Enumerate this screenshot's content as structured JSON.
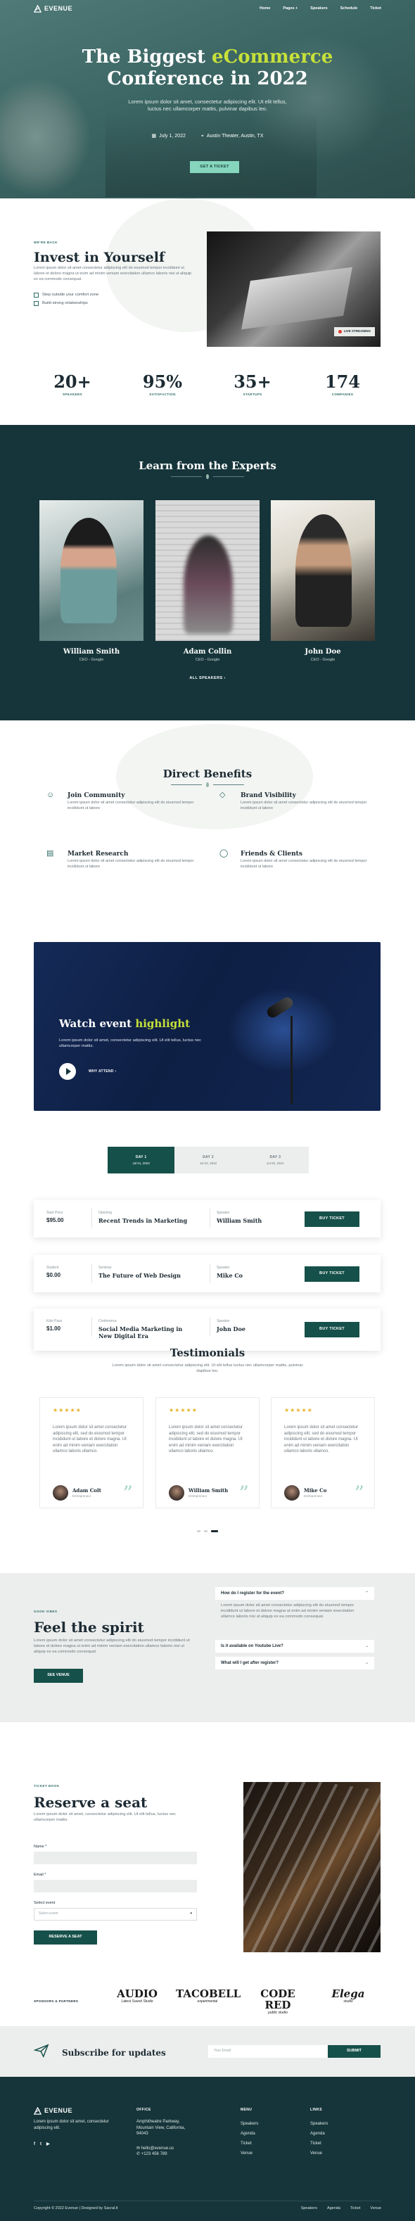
{
  "brand": {
    "name": "EVENUE",
    "accent": "#c7e03a",
    "primary": "#16504a",
    "dark": "#16353a",
    "mint": "#86d6bd"
  },
  "nav": {
    "items": [
      "Home",
      "Pages +",
      "Speakers",
      "Schedule",
      "Ticket"
    ]
  },
  "hero": {
    "title_a": "The Biggest ",
    "title_hl": "eCommerce",
    "title_b": "Conference in 2022",
    "sub_1": "Lorem ipsum dolor sit amet, consectetur adipiscing elit. Ut elit tellus,",
    "sub_2": "luctus nec ullamcorper mattis, pulvinar dapibus leo.",
    "date": "July 1, 2022",
    "place": "Austin Theater, Austin, TX",
    "cta": "GET A TICKET"
  },
  "invest": {
    "eyebrow": "WE'RE BACK",
    "title": "Invest in Yourself",
    "text": "Lorem ipsum dolor sit amet consectetur adipiscing elit do eiusmod tempor incididunt ut labore et dolore magna ut enim ad minim veniam exercitation ullamco laboris nisi ut aliquip ex ea commodo consequat.",
    "check_1": "Step outside your comfort zone",
    "check_2": "Build strong relationships",
    "live": "LIVE STREAMING"
  },
  "stats": [
    {
      "n": "20+",
      "l": "SPEAKERS"
    },
    {
      "n": "95%",
      "l": "SATISFACTION"
    },
    {
      "n": "35+",
      "l": "STARTUPS"
    },
    {
      "n": "174",
      "l": "COMPANIES"
    }
  ],
  "experts": {
    "title": "Learn from the Experts",
    "all": "ALL SPEAKERS  ›",
    "speakers": [
      {
        "name": "William Smith",
        "role": "CEO - Google"
      },
      {
        "name": "Adam Collin",
        "role": "CEO - Google"
      },
      {
        "name": "John Doe",
        "role": "CEO - Google"
      }
    ]
  },
  "benefits": {
    "title": "Direct Benefits",
    "items": [
      {
        "t": "Join Community",
        "d": "Lorem ipsum dolor sit amet consectetur adipiscing elit do eiusmod tempor incididunt ut labore"
      },
      {
        "t": "Brand Visibility",
        "d": "Lorem ipsum dolor sit amet consectetur adipiscing elit do eiusmod tempor incididunt ut labore"
      },
      {
        "t": "Market Research",
        "d": "Lorem ipsum dolor sit amet consectetur adipiscing elit do eiusmod tempor incididunt ut labore"
      },
      {
        "t": "Friends & Clients",
        "d": "Lorem ipsum dolor sit amet consectetur adipiscing elit do eiusmod tempor incididunt ut labore"
      }
    ]
  },
  "video": {
    "title_a": "Watch event ",
    "title_hl": "highlight",
    "text": "Lorem ipsum dolor sit amet, consectetur adipiscing elit. Ut elit tellus, luctus nec ullamcorper mattis.",
    "why": "WHY ATTEND  ›"
  },
  "days": [
    {
      "l": "DAY 1",
      "d": "Jul 01, 2022"
    },
    {
      "l": "DAY 2",
      "d": "Jul 02, 2022"
    },
    {
      "l": "DAY 3",
      "d": "Jul 03, 2022"
    }
  ],
  "tickets": [
    {
      "k1": "Start Price",
      "v1": "$95.00",
      "k2": "Opening",
      "v2": "Recent Trends in Marketing",
      "k3": "Speaker",
      "v3": "William Smith",
      "b": "BUY TICKET"
    },
    {
      "k1": "Student",
      "v1": "$0.00",
      "k2": "Seminar",
      "v2": "The Future of Web Design",
      "k3": "Speaker",
      "v3": "Mike Co",
      "b": "BUY TICKET"
    },
    {
      "k1": "Kids Pass",
      "v1": "$1.00",
      "k2": "Conference",
      "v2": "Social Media Marketing in New Digital Era",
      "k3": "Speaker",
      "v3": "John Doe",
      "b": "BUY TICKET"
    }
  ],
  "testimonials": {
    "title": "Testimonials",
    "text": "Lorem ipsum dolor sit amet consectetur adipiscing elit. Ut elit tellus luctus nec ullamcorper mattis, pulvinar dapibus leo.",
    "items": [
      {
        "q": "Lorem ipsum dolor sit amet consectetur adipiscing elit, sed do eiusmod tempor incididunt ut labore et dolore magna. Ut enim ad minim veniam exercitation ullamco laboris ullamco.",
        "n": "Adam Colt",
        "r": "Entrepreneur"
      },
      {
        "q": "Lorem ipsum dolor sit amet consectetur adipiscing elit, sed do eiusmod tempor incididunt ut labore et dolore magna. Ut enim ad minim veniam exercitation ullamco laboris ullamco.",
        "n": "William Smith",
        "r": "Entrepreneur"
      },
      {
        "q": "Lorem ipsum dolor sit amet consectetur adipiscing elit, sed do eiusmod tempor incididunt ut labore et dolore magna. Ut enim ad minim veniam exercitation ullamco laboris ullamco.",
        "n": "Mike Co",
        "r": "Entrepreneur"
      }
    ]
  },
  "faq": {
    "eyebrow": "GOOD VIBES",
    "title": "Feel the spirit",
    "text": "Lorem ipsum dolor sit amet consectetur adipiscing elit do eiusmod tempor incididunt ut labore et dolore magna ut enim ad minim veniam exercitation ullamco laboris nisi ut aliquip ex ea commodo consequat.",
    "btn": "SEE VENUE",
    "q1": "How do I register for the event?",
    "a1": "Lorem ipsum dolor sit amet consectetur adipiscing elit do eiusmod tempor incididunt ut labore et dolore magna ut enim ad minim veniam exercitation ullamco laboris nisi ut aliquip ex ea commodo consequat.",
    "q2": "Is it available on Youtube Live?",
    "q3": "What will I get after register?"
  },
  "reserve": {
    "eyebrow": "TICKET BOOK",
    "title": "Reserve a seat",
    "text": "Lorem ipsum dolor sit amet, consectetur adipiscing elit. Ut elit tellus, luctus nec ullamcorper mattis.",
    "name_l": "Name *",
    "email_l": "Email *",
    "event_l": "Select event",
    "event_v": "Select event",
    "btn": "RESERVE A SEAT"
  },
  "sponsors": {
    "label": "SPONSORS & PARTNERS",
    "items": [
      {
        "b": "AUDIO",
        "s": "Latest Sound Studio"
      },
      {
        "b": "TACOBELL",
        "s": "experimental"
      },
      {
        "b": "CODE RED",
        "s": "public studio"
      },
      {
        "b": "Elega",
        "s": "studio"
      }
    ]
  },
  "subscribe": {
    "title": "Subscribe for updates",
    "ph": "Your Email",
    "btn": "SUBMIT"
  },
  "footer": {
    "text": "Lorem ipsum dolor sit amet, consectetur adipiscing elit.",
    "office_h": "OFFICE",
    "addr_1": "Amphitheatre Parkway,",
    "addr_2": "Mountain View, California,",
    "addr_3": "94043",
    "email": "hello@evenue.us",
    "phone": "+123 456 789",
    "menu_h": "MENU",
    "menu": [
      "Speakers",
      "Agenda",
      "Ticket",
      "Venue"
    ],
    "links_h": "LINKS",
    "links": [
      "Speakers",
      "Agenda",
      "Ticket",
      "Venue"
    ],
    "copy": "Copyright © 2022 Evenue | Designed by Sacral.lt",
    "bottom": [
      "Speakers",
      "Agenda",
      "Ticket",
      "Venue"
    ]
  }
}
